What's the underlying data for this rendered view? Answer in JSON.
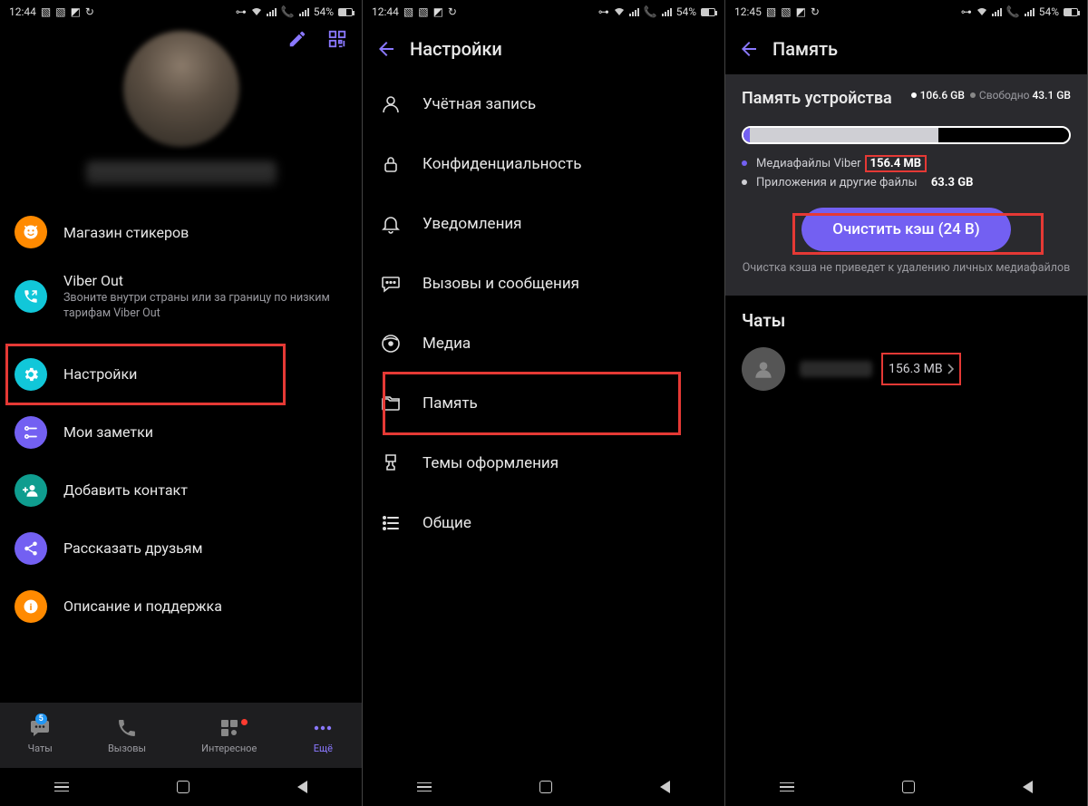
{
  "status": {
    "time_a": "12:44",
    "time_b": "12:44",
    "time_c": "12:45",
    "battery": "54%"
  },
  "screen1": {
    "edit": "✎",
    "menu": {
      "stickers": "Магазин стикеров",
      "viberout": "Viber Out",
      "viberout_sub": "Звоните внутри страны или за границу по низким тарифам Viber Out",
      "settings": "Настройки",
      "notes": "Мои заметки",
      "addcontact": "Добавить контакт",
      "share": "Рассказать друзьям",
      "help": "Описание и поддержка"
    },
    "nav": {
      "chats": "Чаты",
      "chats_badge": "5",
      "calls": "Вызовы",
      "explore": "Интересное",
      "more": "Ещё"
    }
  },
  "screen2": {
    "title": "Настройки",
    "items": {
      "account": "Учётная запись",
      "privacy": "Конфиденциальность",
      "notifications": "Уведомления",
      "calls": "Вызовы и сообщения",
      "media": "Медиа",
      "storage": "Память",
      "themes": "Темы оформления",
      "general": "Общие"
    }
  },
  "screen3": {
    "title": "Память",
    "device_label": "Память устройства",
    "total": "106.6 GB",
    "free_label": "Свободно",
    "free": "43.1 GB",
    "legend_viber": "Медиафайлы Viber",
    "legend_viber_val": "156.4 MB",
    "legend_other": "Приложения и другие файлы",
    "legend_other_val": "63.3 GB",
    "clear_btn": "Очистить кэш (24 B)",
    "note": "Очистка кэша не приведет к удалению личных медиафайлов",
    "chats_title": "Чаты",
    "chat_size": "156.3 MB"
  }
}
